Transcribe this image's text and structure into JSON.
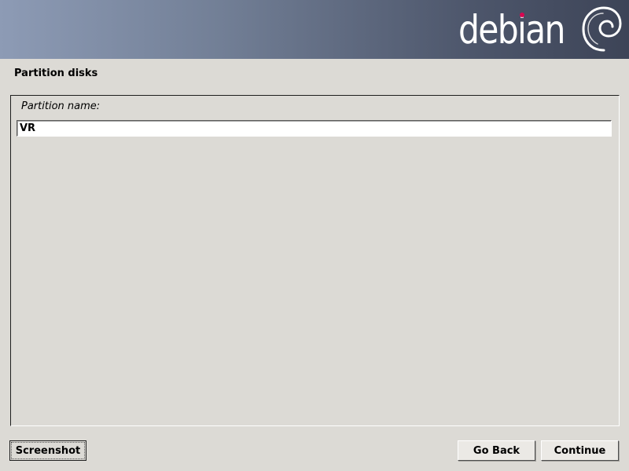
{
  "banner": {
    "logo_text": "debian",
    "logo_icon": "debian-swirl-icon",
    "accent_color": "#d70751"
  },
  "page": {
    "title": "Partition disks"
  },
  "form": {
    "partition_name_label": "Partition name:",
    "partition_name_value": "VR"
  },
  "buttons": {
    "screenshot_label": "Screenshot",
    "go_back_label": "Go Back",
    "continue_label": "Continue"
  }
}
